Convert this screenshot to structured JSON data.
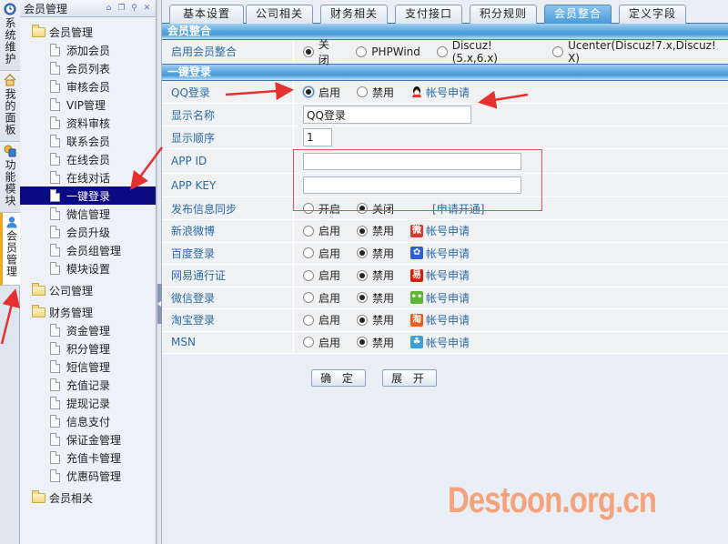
{
  "left_tabs": [
    {
      "label": "系统维护",
      "icon": "clock-icon"
    },
    {
      "label": "我的面板",
      "icon": "home-icon"
    },
    {
      "label": "功能模块",
      "icon": "modules-icon"
    },
    {
      "label": "会员管理",
      "icon": "user-icon",
      "active": true
    }
  ],
  "panel": {
    "title": "会员管理",
    "tools": [
      "home-icon",
      "restore-icon",
      "search-icon",
      "close-icon"
    ]
  },
  "tree": [
    {
      "label": "会员管理",
      "items": [
        "添加会员",
        "会员列表",
        "审核会员",
        "VIP管理",
        "资料审核",
        "联系会员",
        "在线会员",
        "在线对话",
        "一键登录",
        "微信管理",
        "会员升级",
        "会员组管理",
        "模块设置"
      ],
      "selected": "一键登录"
    },
    {
      "label": "公司管理",
      "items": []
    },
    {
      "label": "财务管理",
      "items": [
        "资金管理",
        "积分管理",
        "短信管理",
        "充值记录",
        "提现记录",
        "信息支付",
        "保证金管理",
        "充值卡管理",
        "优惠码管理"
      ]
    },
    {
      "label": "会员相关",
      "items": []
    }
  ],
  "tabs": [
    {
      "label": "基本设置"
    },
    {
      "label": "公司相关"
    },
    {
      "label": "财务相关"
    },
    {
      "label": "支付接口"
    },
    {
      "label": "积分规则"
    },
    {
      "label": "会员整合",
      "active": true
    },
    {
      "label": "定义字段"
    }
  ],
  "section1": {
    "title": "会员整合",
    "row_label": "启用会员整合",
    "options": [
      "关闭",
      "PHPWind",
      "Discuz!(5.x,6.x)",
      "Ucenter(Discuz!7.x,Discuz! X)"
    ],
    "selected": "关闭"
  },
  "section2": {
    "title": "一键登录",
    "qq": {
      "label": "QQ登录",
      "enable": "启用",
      "disable": "禁用",
      "selected": "启用",
      "apply": "帐号申请",
      "apply_icon": "qq-icon"
    },
    "display_name": {
      "label": "显示名称",
      "value": "QQ登录"
    },
    "display_order": {
      "label": "显示顺序",
      "value": "1"
    },
    "app_id": {
      "label": "APP ID",
      "value": ""
    },
    "app_key": {
      "label": "APP KEY",
      "value": ""
    },
    "sync": {
      "label": "发布信息同步",
      "on": "开启",
      "off": "关闭",
      "selected": "关闭",
      "link": "[申请开通]"
    },
    "providers": [
      {
        "label": "新浪微博",
        "enable": "启用",
        "disable": "禁用",
        "selected": "禁用",
        "apply": "帐号申请",
        "icon": "weibo-icon",
        "color": "#e2372b",
        "glyph": "微"
      },
      {
        "label": "百度登录",
        "enable": "启用",
        "disable": "禁用",
        "selected": "禁用",
        "apply": "帐号申请",
        "icon": "baidu-icon",
        "color": "#2f5fd8",
        "glyph": "✿"
      },
      {
        "label": "网易通行证",
        "enable": "启用",
        "disable": "禁用",
        "selected": "禁用",
        "apply": "帐号申请",
        "icon": "netease-icon",
        "color": "#d81e06",
        "glyph": "易"
      },
      {
        "label": "微信登录",
        "enable": "启用",
        "disable": "禁用",
        "selected": "禁用",
        "apply": "帐号申请",
        "icon": "wechat-icon",
        "color": "#5cb833",
        "glyph": "••"
      },
      {
        "label": "淘宝登录",
        "enable": "启用",
        "disable": "禁用",
        "selected": "禁用",
        "apply": "帐号申请",
        "icon": "taobao-icon",
        "color": "#f25a1c",
        "glyph": "淘"
      },
      {
        "label": "MSN",
        "enable": "启用",
        "disable": "禁用",
        "selected": "禁用",
        "apply": "帐号申请",
        "icon": "msn-icon",
        "color": "#3aa0d8",
        "glyph": "♣"
      }
    ]
  },
  "buttons": {
    "confirm": "确 定",
    "expand": "展 开"
  },
  "watermark": "Destoon.org.cn",
  "colors": {
    "selected_bg": "#0b0a80",
    "label_blue": "#2b6aa8",
    "annotation_red": "#e03030",
    "watermark": "#f4a37c"
  }
}
